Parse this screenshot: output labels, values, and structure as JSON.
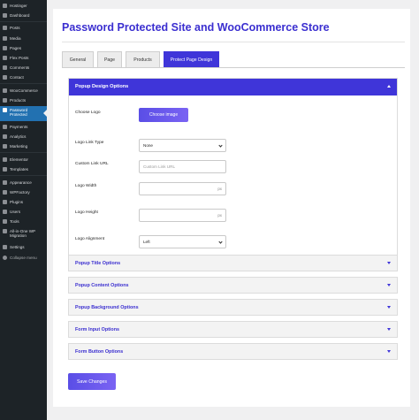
{
  "sidebar": {
    "items": [
      {
        "label": "Hostinger",
        "icon": "hostinger-icon"
      },
      {
        "label": "Dashboard",
        "icon": "dashboard-icon"
      },
      {
        "label": "Posts",
        "icon": "pin-icon"
      },
      {
        "label": "Media",
        "icon": "media-icon"
      },
      {
        "label": "Pages",
        "icon": "page-icon"
      },
      {
        "label": "Flex Posts",
        "icon": "flex-icon"
      },
      {
        "label": "Comments",
        "icon": "comment-icon"
      },
      {
        "label": "Contact",
        "icon": "mail-icon"
      },
      {
        "label": "WooCommerce",
        "icon": "woo-icon"
      },
      {
        "label": "Products",
        "icon": "box-icon"
      },
      {
        "label": "Password",
        "label2": "Protected",
        "icon": "lock-icon"
      },
      {
        "label": "Payments",
        "icon": "card-icon"
      },
      {
        "label": "Analytics",
        "icon": "chart-icon"
      },
      {
        "label": "Marketing",
        "icon": "megaphone-icon"
      },
      {
        "label": "Elementor",
        "icon": "elementor-icon"
      },
      {
        "label": "Templates",
        "icon": "folder-icon"
      },
      {
        "label": "Appearance",
        "icon": "brush-icon"
      },
      {
        "label": "WPFactory",
        "icon": "factory-icon"
      },
      {
        "label": "Plugins",
        "icon": "plug-icon"
      },
      {
        "label": "Users",
        "icon": "user-icon"
      },
      {
        "label": "Tools",
        "icon": "wrench-icon"
      },
      {
        "label": "All-in-One WP",
        "label2": "Migration",
        "icon": "migration-icon"
      },
      {
        "label": "Settings",
        "icon": "settings-icon"
      },
      {
        "label": "Collapse menu",
        "icon": "collapse-icon"
      }
    ],
    "accent": "#2271b1",
    "background": "#1d2327"
  },
  "main": {
    "title": "Password Protected Site and WooCommerce Store",
    "tabs": [
      {
        "label": "General"
      },
      {
        "label": "Page"
      },
      {
        "label": "Products"
      },
      {
        "label": "Protect Page Design"
      }
    ],
    "active_tab": "Protect Page Design",
    "panel": {
      "title": "Popup Design Options",
      "choose_logo_label": "Choose Logo",
      "choose_image_button": "Choose image",
      "logo_link_type_label": "Logo Link Type",
      "logo_link_type_value": "None",
      "custom_link_url_label": "Custom Link URL",
      "custom_link_url_placeholder": "Custom Link URL",
      "logo_width_label": "Logo Width",
      "logo_width_unit": "px",
      "logo_height_label": "Logo Height",
      "logo_height_unit": "px",
      "logo_alignment_label": "Logo Alignment",
      "logo_alignment_value": "Left"
    },
    "accordions": [
      {
        "label": "Popup Title Options"
      },
      {
        "label": "Popup Content Options"
      },
      {
        "label": "Popup Background Options"
      },
      {
        "label": "Form Input Options"
      },
      {
        "label": "Form Button Options"
      }
    ],
    "save_button": "Save Changes",
    "accent": "#3f35d9"
  }
}
